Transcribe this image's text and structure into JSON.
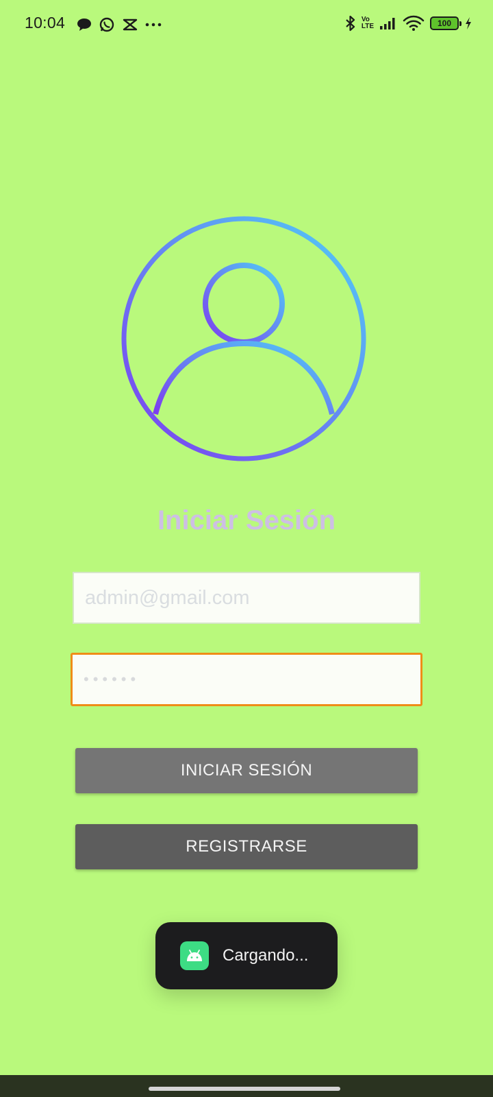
{
  "status_bar": {
    "time": "10:04",
    "left_icons": [
      "message-icon",
      "whatsapp-icon",
      "capcut-icon",
      "more-dots-icon"
    ],
    "right_icons": [
      "bluetooth-icon",
      "volte-icon",
      "signal-icon",
      "wifi-icon",
      "battery-icon",
      "charging-icon"
    ],
    "volte_top": "Vo",
    "volte_bottom": "LTE",
    "battery_level": "100"
  },
  "login": {
    "title": "Iniciar Sesión",
    "email_placeholder": "admin@gmail.com",
    "password_mask": "••••••",
    "login_button": "INICIAR SESIÓN",
    "register_button": "REGISTRARSE"
  },
  "toast": {
    "message": "Cargando...",
    "icon": "android-icon"
  },
  "colors": {
    "background": "#b9f97c",
    "avatar_gradient_start": "#7d3cf0",
    "avatar_gradient_end": "#4fd0f5",
    "title": "#cdbfe4",
    "password_border": "#ef8d18",
    "login_button": "#757575",
    "register_button": "#5d5d5d",
    "toast_background": "#1c1c1e"
  }
}
